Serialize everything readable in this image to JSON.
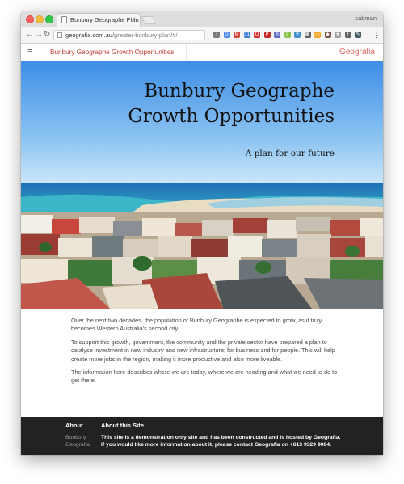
{
  "browser": {
    "tab_title": "Bunbury Geographe Plan",
    "tab_close": "×",
    "profile_name": "sabman",
    "url_host": "geografia.com.au",
    "url_path": "/greater-bunbury-plan/#/",
    "back_glyph": "←",
    "forward_glyph": "→",
    "reload_glyph": "↻",
    "menu_glyph": "⋮",
    "extension_icons": [
      "info-icon",
      "translate-icon",
      "gmail-icon",
      "calendar-icon",
      "opera-icon",
      "pinterest-icon",
      "extension-icon",
      "clip-icon",
      "snowflake-icon",
      "grid-icon",
      "folder-icon",
      "box-icon",
      "star-icon",
      "formula-icon",
      "pen-icon"
    ],
    "extension_colors": [
      "#7a7a7a",
      "#4a86e8",
      "#d44638",
      "#3b7ddd",
      "#d32f2f",
      "#c62828",
      "#5c6bc0",
      "#8bc34a",
      "#3d8fd1",
      "#616161",
      "#f4a623",
      "#795548",
      "#9e9e9e",
      "#616161",
      "#455a64"
    ],
    "extension_glyphs": [
      "i",
      "G",
      "M",
      "31",
      "O",
      "P",
      "◎",
      "c",
      "✳",
      "▦",
      "▭",
      "◆",
      "★",
      "ƒ",
      "✎"
    ]
  },
  "header": {
    "menu_glyph": "≡",
    "site_title": "Bunbury Geographe Growth Opportunities",
    "brand": "Geografia",
    "title_color": "#c23a35",
    "brand_color": "#e0605a"
  },
  "hero": {
    "title_line1": "Bunbury Geographe",
    "title_line2": "Growth Opportunities",
    "subtitle": "A plan for our future"
  },
  "content": {
    "paragraphs": [
      "Over the next two decades, the population of Bunbury Geographe is expected to grow, as it truly becomes Western Australia's second city.",
      "To support this growth, government, the community and the private sector have prepared a plan to catalyse investment in new industry and new infrastructure; for business and for people. This will help create more jobs in the region, making it more productive and also more liveable.",
      "The information here describes where we are today, where we are heading and what we need to do to get there."
    ]
  },
  "footer": {
    "about_heading": "About",
    "about_site_heading": "About this Site",
    "link_line1": "Bunbury",
    "link_line2": "Geografia",
    "about_text": "This site is a demonstration only site and has been constructed and is hosted by Geografia. If you would like more information about it, please contact Geografia on +613 9329 9004."
  }
}
